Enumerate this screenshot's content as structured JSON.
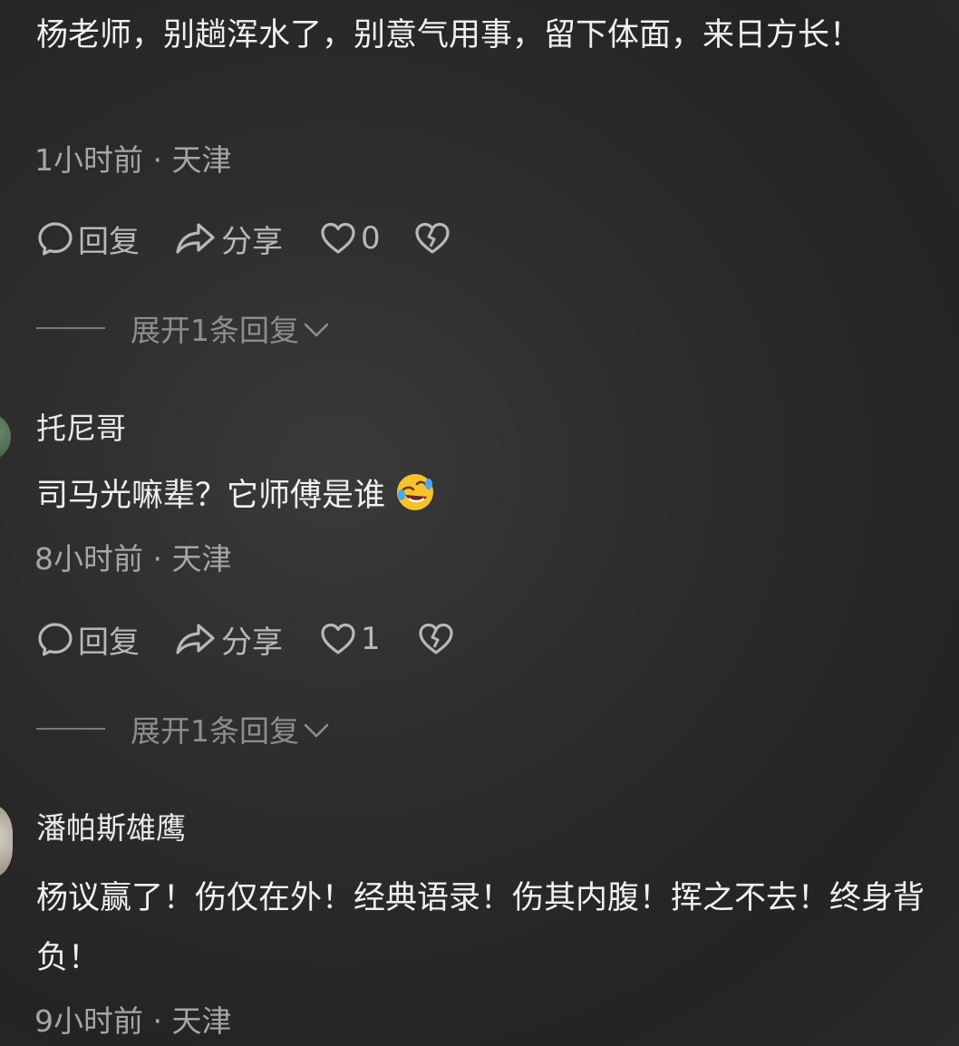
{
  "comments": [
    {
      "username": "",
      "text": "杨老师，别趟浑水了，别意气用事，留下体面，来日方长！",
      "time": "1小时前",
      "location": "天津",
      "reply_label": "回复",
      "share_label": "分享",
      "like_count": "0",
      "expand_label": "展开1条回复"
    },
    {
      "username": "托尼哥",
      "text": "司马光嘛辈？它师傅是谁",
      "emoji": "rolling-laughing-emoji",
      "time": "8小时前",
      "location": "天津",
      "reply_label": "回复",
      "share_label": "分享",
      "like_count": "1",
      "expand_label": "展开1条回复"
    },
    {
      "username": "潘帕斯雄鹰",
      "text": "杨议赢了！伤仅在外！经典语录！伤其内腹！挥之不去！终身背负！",
      "time": "9小时前",
      "location": "天津"
    }
  ],
  "meta_separator": " · ",
  "icons": {
    "reply": "speech-bubble-icon",
    "share": "share-arrow-icon",
    "like": "heart-icon",
    "dislike": "broken-heart-icon",
    "expand": "chevron-down-icon"
  }
}
